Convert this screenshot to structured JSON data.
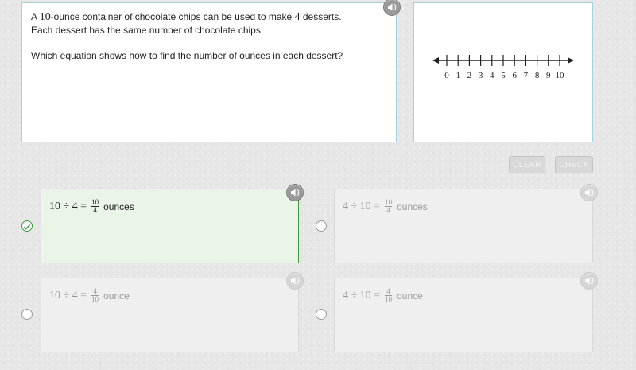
{
  "question": {
    "line1_pre": "A ",
    "line1_num1": "10",
    "line1_mid": "-ounce container of chocolate chips can be used to make ",
    "line1_num2": "4",
    "line1_post": " desserts.",
    "line2": "Each dessert has the same number of chocolate chips.",
    "line3": "Which equation shows how to find the number of ounces in each dessert?",
    "audio_icon": "speaker-icon"
  },
  "number_line": {
    "min": 0,
    "max": 10,
    "major_labels": [
      "0",
      "1",
      "2",
      "3",
      "4",
      "5",
      "6",
      "7",
      "8",
      "9",
      "10"
    ]
  },
  "buttons": {
    "clear": "CLEAR",
    "check": "CHECK"
  },
  "choices": [
    {
      "left": "10 ÷ 4 =",
      "num": "10",
      "den": "4",
      "unit": "ounces",
      "selected": true
    },
    {
      "left": "4 ÷ 10 =",
      "num": "10",
      "den": "4",
      "unit": "ounces",
      "selected": false
    },
    {
      "left": "10 ÷ 4 =",
      "num": "4",
      "den": "10",
      "unit": "ounce",
      "selected": false
    },
    {
      "left": "4 ÷ 10 =",
      "num": "4",
      "den": "10",
      "unit": "ounce",
      "selected": false
    }
  ],
  "colors": {
    "selected_border": "#3e9a3e",
    "selected_bg": "#e9f5e7",
    "panel_border": "#9fd4d9"
  }
}
